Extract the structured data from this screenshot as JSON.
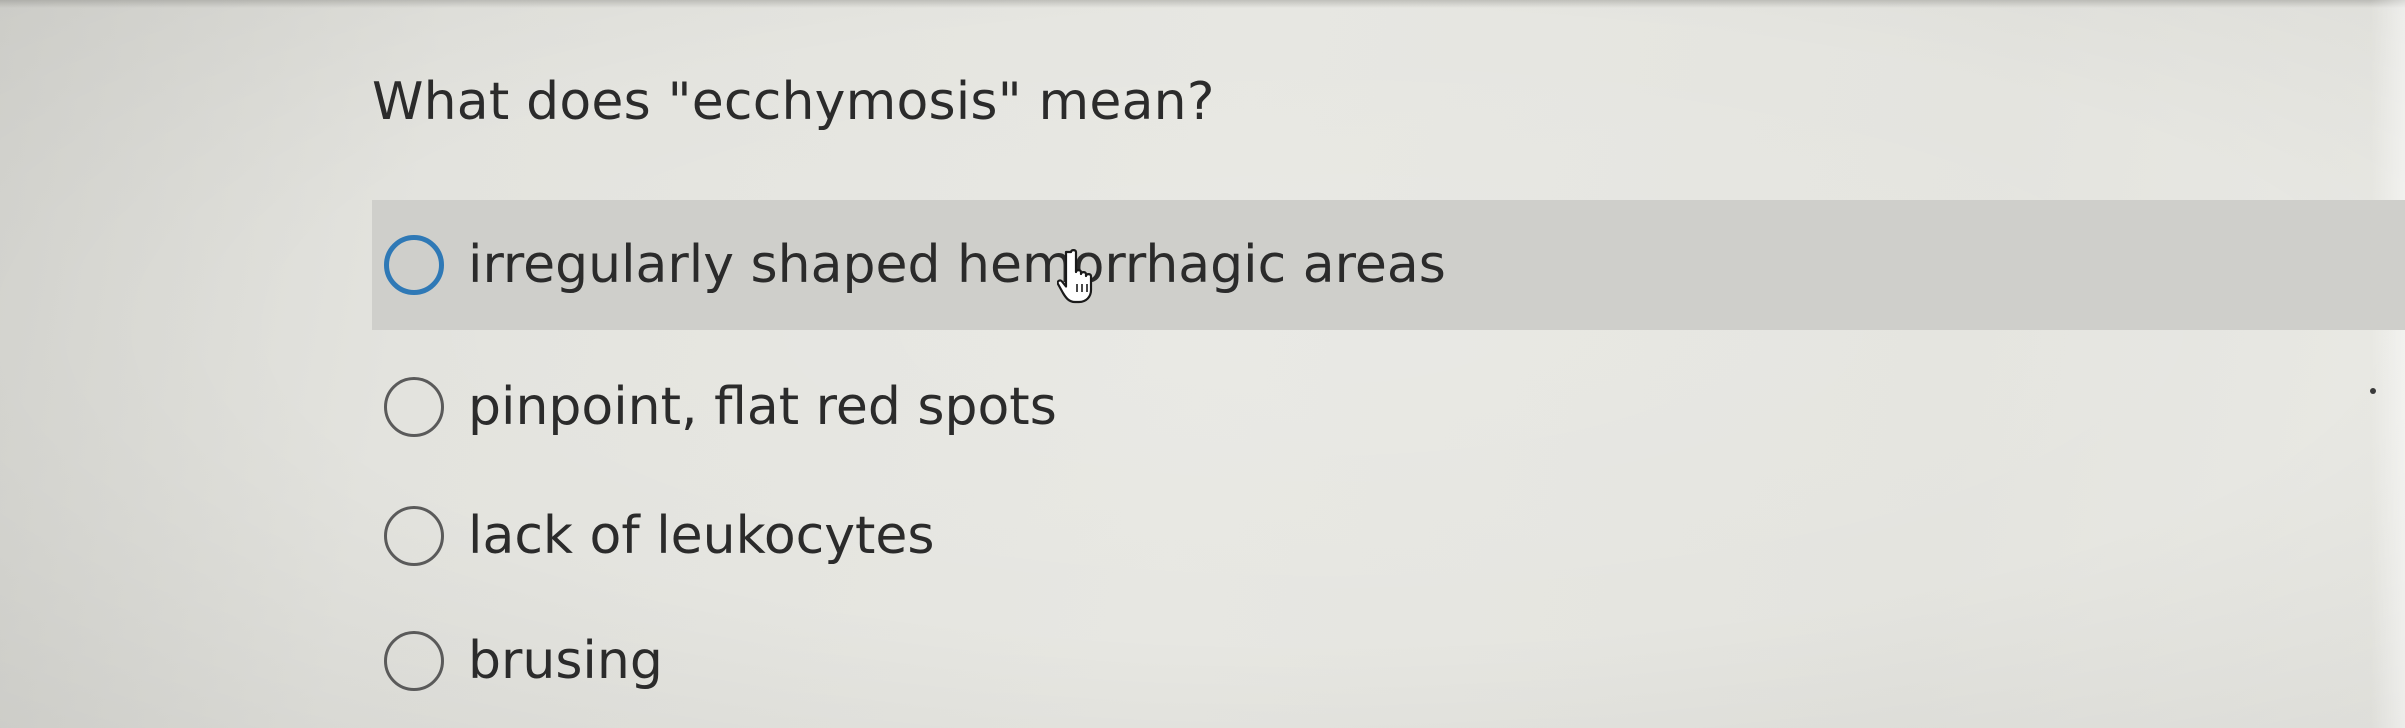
{
  "question": {
    "prompt": "What does \"ecchymosis\" mean?",
    "options": [
      {
        "label": "irregularly shaped hemorrhagic areas",
        "selected": false,
        "hovered": true
      },
      {
        "label": "pinpoint, flat red spots",
        "selected": false,
        "hovered": false
      },
      {
        "label": "lack of leukocytes",
        "selected": false,
        "hovered": false
      },
      {
        "label": "brusing",
        "selected": false,
        "hovered": false
      }
    ]
  },
  "colors": {
    "focus_ring": "#2f79b6",
    "hover_row": "#cfcfcb",
    "text": "#2b2b2b"
  },
  "icons": {
    "cursor": "hand-pointer-icon"
  }
}
